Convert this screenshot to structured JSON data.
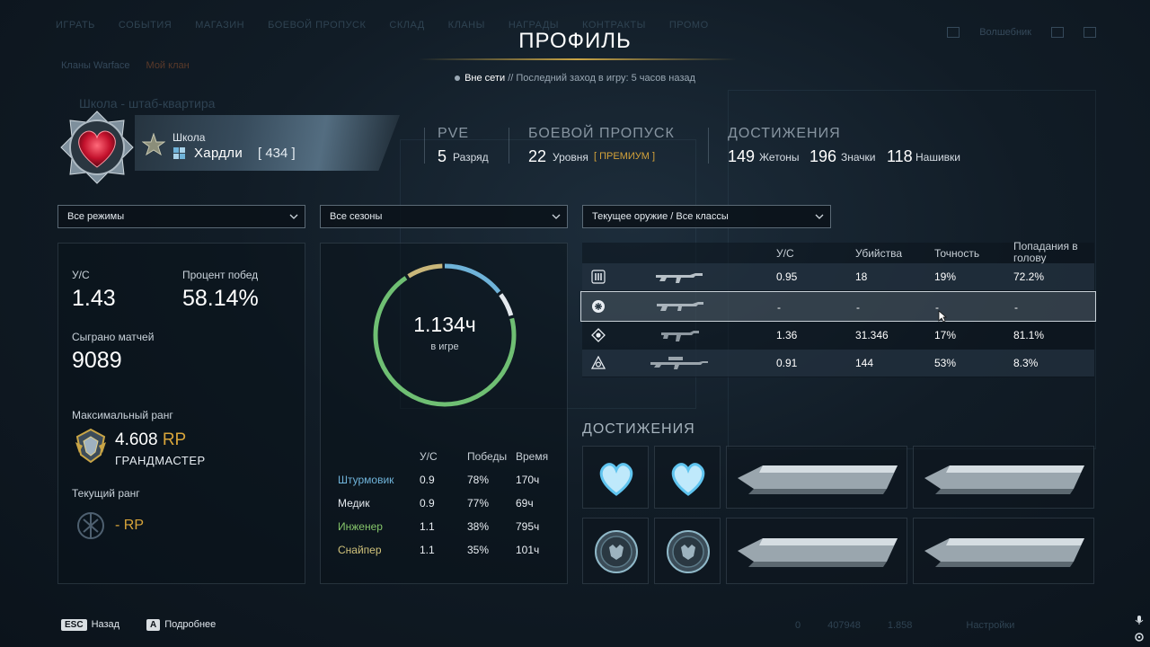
{
  "background_nav": [
    "ИГРАТЬ",
    "СОБЫТИЯ",
    "МАГАЗИН",
    "БОЕВОЙ ПРОПУСК",
    "СКЛАД",
    "КЛАНЫ",
    "НАГРАДЫ",
    "КОНТРАКТЫ",
    "ПРОМО"
  ],
  "background_tabs": [
    "Кланы Warface",
    "Мой клан"
  ],
  "background_subtitle": "Школа - штаб-квартира",
  "background_user": "Волшебник",
  "background_footer": {
    "count1": "0",
    "count2": "407948",
    "count3": "1.858",
    "settings": "Настройки"
  },
  "page": {
    "title": "ПРОФИЛЬ",
    "status_online": "Вне сети",
    "status_separator": "//",
    "status_last_login": "Последний заход в игру: 5 часов назад"
  },
  "player": {
    "clan": "Школа",
    "nickname": "Хардли",
    "level": "[ 434 ]"
  },
  "headline": {
    "pve": {
      "label": "PVE",
      "value": "5",
      "unit": "Разряд"
    },
    "battlepass": {
      "label": "БОЕВОЙ ПРОПУСК",
      "value": "22",
      "unit": "Уровня",
      "badge": "[ ПРЕМИУМ ]"
    },
    "achievements": {
      "label": "ДОСТИЖЕНИЯ",
      "tokens": "149",
      "tokens_label": "Жетоны",
      "badges": "196",
      "badges_label": "Значки",
      "stripes": "118",
      "stripes_label": "Нашивки"
    }
  },
  "filters": {
    "modes": "Все режимы",
    "seasons": "Все сезоны",
    "weapons": "Текущее оружие / Все классы"
  },
  "summary": {
    "kd_label": "У/С",
    "kd_value": "1.43",
    "winrate_label": "Процент побед",
    "winrate_value": "58.14%",
    "matches_label": "Сыграно матчей",
    "matches_value": "9089",
    "max_rank_label": "Максимальный ранг",
    "max_rank_rp": "4.608",
    "rp": "RP",
    "max_rank_name": "ГРАНДМАСТЕР",
    "current_rank_label": "Текущий ранг",
    "current_rank_rp": "-"
  },
  "playtime": {
    "value": "1.134ч",
    "label": "в игре",
    "segments": [
      {
        "name": "Штурмовик",
        "fraction": 0.15,
        "color": "#6fb3d9"
      },
      {
        "name": "Медик",
        "fraction": 0.061,
        "color": "#e4e9ee"
      },
      {
        "name": "Инженер",
        "fraction": 0.701,
        "color": "#6fbf73"
      },
      {
        "name": "Снайпер",
        "fraction": 0.089,
        "color": "#c9b77a"
      }
    ]
  },
  "class_table": {
    "headers": [
      "У/С",
      "Победы",
      "Время"
    ],
    "rows": [
      {
        "name": "Штурмовик",
        "kd": "0.9",
        "wins": "78%",
        "time": "170ч"
      },
      {
        "name": "Медик",
        "kd": "0.9",
        "wins": "77%",
        "time": "69ч"
      },
      {
        "name": "Инженер",
        "kd": "1.1",
        "wins": "38%",
        "time": "795ч"
      },
      {
        "name": "Снайпер",
        "kd": "1.1",
        "wins": "35%",
        "time": "101ч"
      }
    ]
  },
  "weapon_table": {
    "headers": [
      "У/С",
      "Убийства",
      "Точность",
      "Попадания в голову"
    ],
    "rows": [
      {
        "class_icon": "rifleman-icon",
        "weapon_icon": "assault-rifle-icon",
        "kd": "0.95",
        "kills": "18",
        "accuracy": "19%",
        "headshots": "72.2%"
      },
      {
        "class_icon": "medic-icon",
        "weapon_icon": "shotgun-icon",
        "kd": "-",
        "kills": "-",
        "accuracy": "-",
        "headshots": "-"
      },
      {
        "class_icon": "engineer-icon",
        "weapon_icon": "smg-icon",
        "kd": "1.36",
        "kills": "31.346",
        "accuracy": "17%",
        "headshots": "81.1%"
      },
      {
        "class_icon": "sniper-icon",
        "weapon_icon": "sniper-rifle-icon",
        "kd": "0.91",
        "kills": "144",
        "accuracy": "53%",
        "headshots": "8.3%"
      }
    ]
  },
  "achievements_title": "ДОСТИЖЕНИЯ",
  "footer": {
    "esc_key": "ESC",
    "back": "Назад",
    "a_key": "A",
    "details": "Подробнее"
  },
  "colors": {
    "gold": "#d8a53a",
    "assault": "#6fb3d9",
    "engineer": "#85c56a",
    "sniper": "#d0c27a"
  }
}
